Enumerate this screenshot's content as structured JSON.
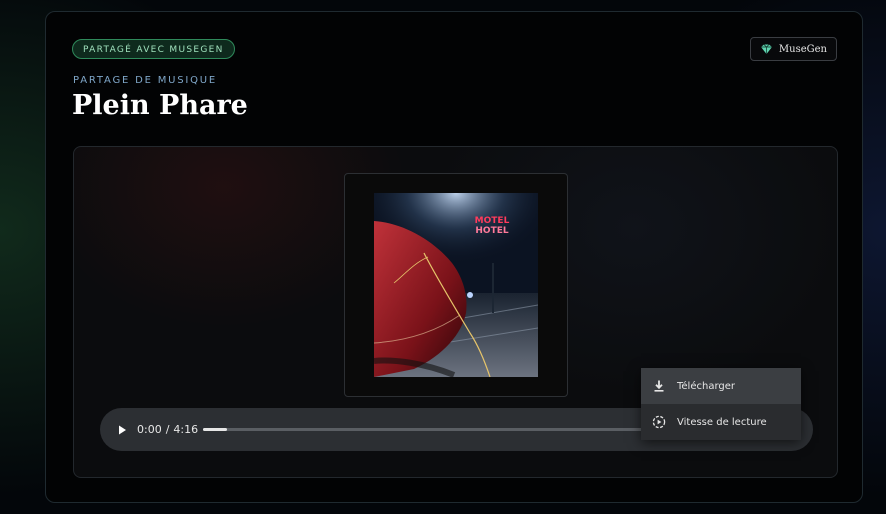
{
  "header": {
    "badge": "PARTAGÉ AVEC MUSEGEN",
    "brand": "MuseGen",
    "eyebrow": "PARTAGE DE MUSIQUE",
    "title": "Plein Phare"
  },
  "artwork": {
    "neon_line1": "MOTEL",
    "neon_line2": "HOTEL"
  },
  "player": {
    "current_time": "0:00",
    "separator": "/",
    "duration": "4:16",
    "progress_fraction": 0.05
  },
  "menu": {
    "items": [
      {
        "label": "Télécharger",
        "icon": "download-icon"
      },
      {
        "label": "Vitesse de lecture",
        "icon": "playback-speed-icon"
      }
    ]
  },
  "colors": {
    "badge_accent": "#2f8a5b",
    "eyebrow": "#7fa6c8",
    "neon": "#ff3b5c"
  }
}
